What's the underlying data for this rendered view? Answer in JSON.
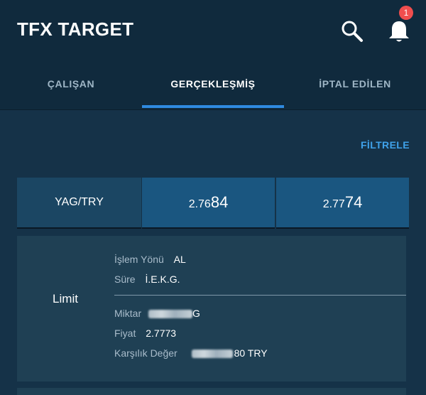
{
  "app": {
    "title": "TFX TARGET",
    "notification_count": "1"
  },
  "tabs": [
    {
      "label": "ÇALIŞAN",
      "active": false
    },
    {
      "label": "GERÇEKLEŞMİŞ",
      "active": true
    },
    {
      "label": "İPTAL EDİLEN",
      "active": false
    }
  ],
  "filter": {
    "label": "FİLTRELE"
  },
  "quote": {
    "symbol": "YAG/TRY",
    "sell_prefix": "2.76",
    "sell_pips": "84",
    "buy_prefix": "2.77",
    "buy_pips": "74"
  },
  "order": {
    "type": "Limit",
    "direction_label": "İşlem Yönü",
    "direction_value": "AL",
    "duration_label": "Süre",
    "duration_value": "İ.E.K.G.",
    "amount_label": "Miktar",
    "amount_value_suffix": "G",
    "price_label": "Fiyat",
    "price_value": "2.7773",
    "counter_label": "Karşılık Değer",
    "counter_value_suffix": "80 TRY"
  },
  "colors": {
    "background": "#153248",
    "appbar": "#102a3d",
    "accent": "#2f8ae0",
    "link": "#3fa2ea",
    "badge": "#f04e4e",
    "quote_symbol_bg": "#1b4663",
    "quote_price_bg": "#1a5680",
    "card_bg": "#1f4054"
  },
  "icons": {
    "search": "search-icon",
    "notifications": "bell-icon"
  }
}
